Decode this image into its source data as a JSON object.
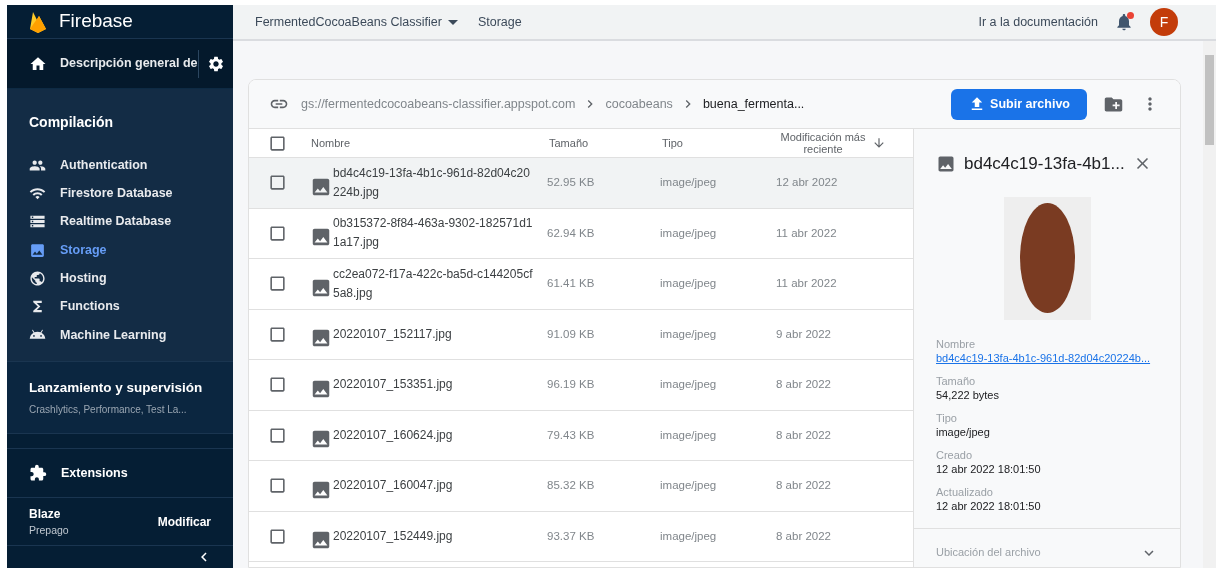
{
  "sidebar": {
    "brand": "Firebase",
    "overview": "Descripción general de",
    "sections": [
      {
        "title": "Compilación",
        "items": [
          {
            "label": "Authentication",
            "selected": false
          },
          {
            "label": "Firestore Database",
            "selected": false
          },
          {
            "label": "Realtime Database",
            "selected": false
          },
          {
            "label": "Storage",
            "selected": true
          },
          {
            "label": "Hosting",
            "selected": false
          },
          {
            "label": "Functions",
            "selected": false
          },
          {
            "label": "Machine Learning",
            "selected": false
          }
        ]
      }
    ],
    "launch": {
      "title": "Lanzamiento y supervisión",
      "subtitle": "Crashlytics, Performance, Test La..."
    },
    "extensions": "Extensions",
    "plan": {
      "name": "Blaze",
      "type": "Prepago",
      "action": "Modificar"
    }
  },
  "topbar": {
    "project": "FermentedCocoaBeans Classifier",
    "page": "Storage",
    "docs": "Ir a la documentación",
    "avatar": "F",
    "notification": true
  },
  "breadcrumb": [
    "gs://fermentedcocoabeans-classifier.appspot.com",
    "cocoabeans",
    "buena_fermenta..."
  ],
  "upload_button": "Subir archivo",
  "table": {
    "select_all_checked": false,
    "columns": [
      "Nombre",
      "Tamaño",
      "Tipo",
      "Modificación más reciente"
    ],
    "rows": [
      {
        "name": "bd4c4c19-13fa-4b1c-961d-82d04c20224b.jpg",
        "size": "52.95 KB",
        "type": "image/jpeg",
        "modified": "12 abr 2022",
        "selected": true,
        "checked": false
      },
      {
        "name": "0b315372-8f84-463a-9302-182571d11a17.jpg",
        "size": "62.94 KB",
        "type": "image/jpeg",
        "modified": "11 abr 2022",
        "selected": false,
        "checked": false
      },
      {
        "name": "cc2ea072-f17a-422c-ba5d-c144205cf5a8.jpg",
        "size": "61.41 KB",
        "type": "image/jpeg",
        "modified": "11 abr 2022",
        "selected": false,
        "checked": false
      },
      {
        "name": "20220107_152117.jpg",
        "size": "91.09 KB",
        "type": "image/jpeg",
        "modified": "9 abr 2022",
        "selected": false,
        "checked": false
      },
      {
        "name": "20220107_153351.jpg",
        "size": "96.19 KB",
        "type": "image/jpeg",
        "modified": "8 abr 2022",
        "selected": false,
        "checked": false
      },
      {
        "name": "20220107_160624.jpg",
        "size": "79.43 KB",
        "type": "image/jpeg",
        "modified": "8 abr 2022",
        "selected": false,
        "checked": false
      },
      {
        "name": "20220107_160047.jpg",
        "size": "85.32 KB",
        "type": "image/jpeg",
        "modified": "8 abr 2022",
        "selected": false,
        "checked": false
      },
      {
        "name": "20220107_152449.jpg",
        "size": "93.37 KB",
        "type": "image/jpeg",
        "modified": "8 abr 2022",
        "selected": false,
        "checked": false
      }
    ]
  },
  "details": {
    "title": "bd4c4c19-13fa-4b1...",
    "fields": [
      {
        "label": "Nombre",
        "value": "bd4c4c19-13fa-4b1c-961d-82d04c20224b...",
        "kind": "link"
      },
      {
        "label": "Tamaño",
        "value": "54,222 bytes",
        "kind": "text"
      },
      {
        "label": "Tipo",
        "value": "image/jpeg",
        "kind": "text"
      },
      {
        "label": "Creado",
        "value": "12 abr 2022 18:01:50",
        "kind": "text"
      },
      {
        "label": "Actualizado",
        "value": "12 abr 2022 18:01:50",
        "kind": "text"
      }
    ],
    "section": "Ubicación del archivo"
  }
}
